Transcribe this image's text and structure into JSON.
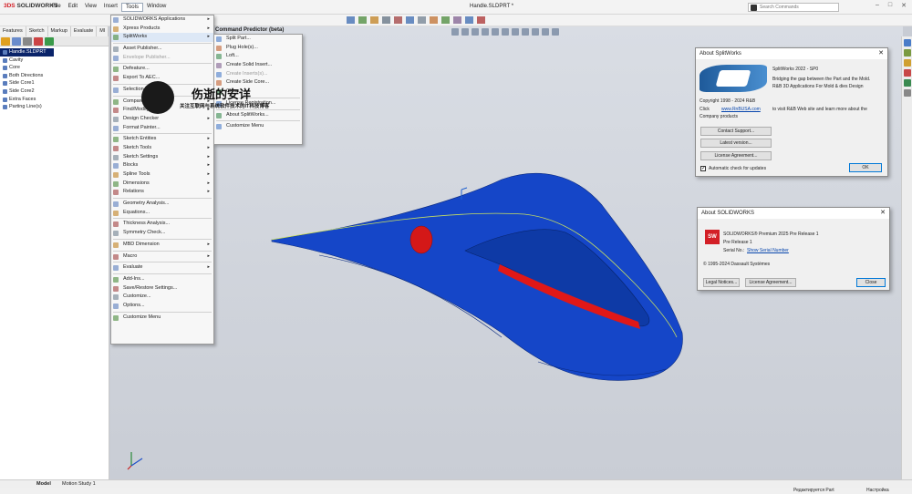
{
  "app": {
    "logo_prefix": "3DS",
    "logo_text": "SOLIDWORKS",
    "document_title": "Handle.SLDPRT *",
    "search_placeholder": "Search Commands"
  },
  "menubar": [
    "File",
    "Edit",
    "View",
    "Insert",
    "Tools",
    "Window"
  ],
  "command_tabs": [
    "Features",
    "Sketch",
    "Markup",
    "Evaluate",
    "MI"
  ],
  "command_predictor": "Command Predictor (beta)",
  "feature_tree": [
    {
      "label": "Handle.SLDPRT",
      "selected": true
    },
    {
      "label": "Cavity"
    },
    {
      "label": "Core"
    },
    {
      "label": "Both Directions"
    },
    {
      "label": "Side Core1"
    },
    {
      "label": "Side Core2"
    },
    {
      "label": "Extra Faces"
    },
    {
      "label": "Parting Line(s)"
    }
  ],
  "tools_menu": [
    {
      "label": "SOLIDWORKS Applications",
      "sub": true
    },
    {
      "label": "Xpress Products",
      "sub": true
    },
    {
      "label": "SplitWorks",
      "sub": true,
      "highlight": true
    },
    {
      "sep": true
    },
    {
      "label": "Asset Publisher..."
    },
    {
      "label": "Envelope Publisher...",
      "disabled": true
    },
    {
      "sep": true
    },
    {
      "label": "Defeature..."
    },
    {
      "label": "Export To AEC..."
    },
    {
      "sep": true
    },
    {
      "label": "Selection Tools",
      "sub": true
    },
    {
      "sep": true
    },
    {
      "label": "Compare",
      "sub": true
    },
    {
      "label": "Find/Modify",
      "sub": true
    },
    {
      "label": "Design Checker",
      "sub": true
    },
    {
      "label": "Format Painter..."
    },
    {
      "sep": true
    },
    {
      "label": "Sketch Entities",
      "sub": true
    },
    {
      "label": "Sketch Tools",
      "sub": true
    },
    {
      "label": "Sketch Settings",
      "sub": true
    },
    {
      "label": "Blocks",
      "sub": true
    },
    {
      "label": "Spline Tools",
      "sub": true
    },
    {
      "label": "Dimensions",
      "sub": true
    },
    {
      "label": "Relations",
      "sub": true
    },
    {
      "sep": true
    },
    {
      "label": "Geometry Analysis..."
    },
    {
      "label": "Equations..."
    },
    {
      "sep": true
    },
    {
      "label": "Thickness Analysis..."
    },
    {
      "label": "Symmetry Check..."
    },
    {
      "sep": true
    },
    {
      "label": "MBD Dimension",
      "sub": true
    },
    {
      "sep": true
    },
    {
      "label": "Macro",
      "sub": true
    },
    {
      "sep": true
    },
    {
      "label": "Evaluate",
      "sub": true
    },
    {
      "sep": true
    },
    {
      "label": "Add-Ins..."
    },
    {
      "label": "Save/Restore Settings..."
    },
    {
      "label": "Customize..."
    },
    {
      "label": "Options..."
    },
    {
      "sep": true
    },
    {
      "label": "Customize Menu"
    }
  ],
  "splitworks_menu": [
    {
      "label": "Split Part..."
    },
    {
      "label": "Plug Hole(s)..."
    },
    {
      "label": "Loft..."
    },
    {
      "label": "Create Solid Insert..."
    },
    {
      "label": "Create Inserts(s)...",
      "disabled": true
    },
    {
      "label": "Create Side Core..."
    },
    {
      "label": "Clean..."
    },
    {
      "sep": true
    },
    {
      "label": "License Registration..."
    },
    {
      "sep": true
    },
    {
      "label": "About SplitWorks..."
    },
    {
      "sep": true
    },
    {
      "label": "Customize Menu"
    }
  ],
  "watermark": {
    "title": "伤逝的安详",
    "subtitle": "关注互联网与系统软件技术的IT科技博客"
  },
  "about_splitworks": {
    "title": "About SplitWorks",
    "version": "SplitWorks 2022 - SP0",
    "desc1": "Bridging the gap between the Part and the Mold.",
    "desc2": "R&B 3D Applications For Mold & dies Design",
    "copyright": "Copyright 1998 - 2024 R&B",
    "click": "Click",
    "link": "www.RnBUSA.com",
    "visit": "to visit R&B Web site and learn more about the",
    "visit2": "Company products",
    "buttons": [
      "Contact Support...",
      "Latest version...",
      "License Agreement..."
    ],
    "auto_check": "Automatic check for updates",
    "ok": "OK"
  },
  "about_solidworks": {
    "title": "About SOLIDWORKS",
    "logo_text": "SW",
    "product": "SOLIDWORKS® Premium 2025 Pre Release 1",
    "prerelease": "Pre Release  1",
    "serial_label": "Serial No.:",
    "serial_link": "Show Serial Number",
    "copyright": "© 1995-2024 Dassault Systèmes",
    "legal": "Legal Notices...",
    "license": "License Agreement...",
    "close": "Close"
  },
  "bottom_tabs": [
    "Model",
    "Motion Study 1"
  ],
  "status": {
    "editing": "Редактируется Part",
    "customize": "Настройка"
  },
  "colors": {
    "part_blue": "#1546c8",
    "accent_red": "#d31f26",
    "selection": "#0a246a"
  }
}
